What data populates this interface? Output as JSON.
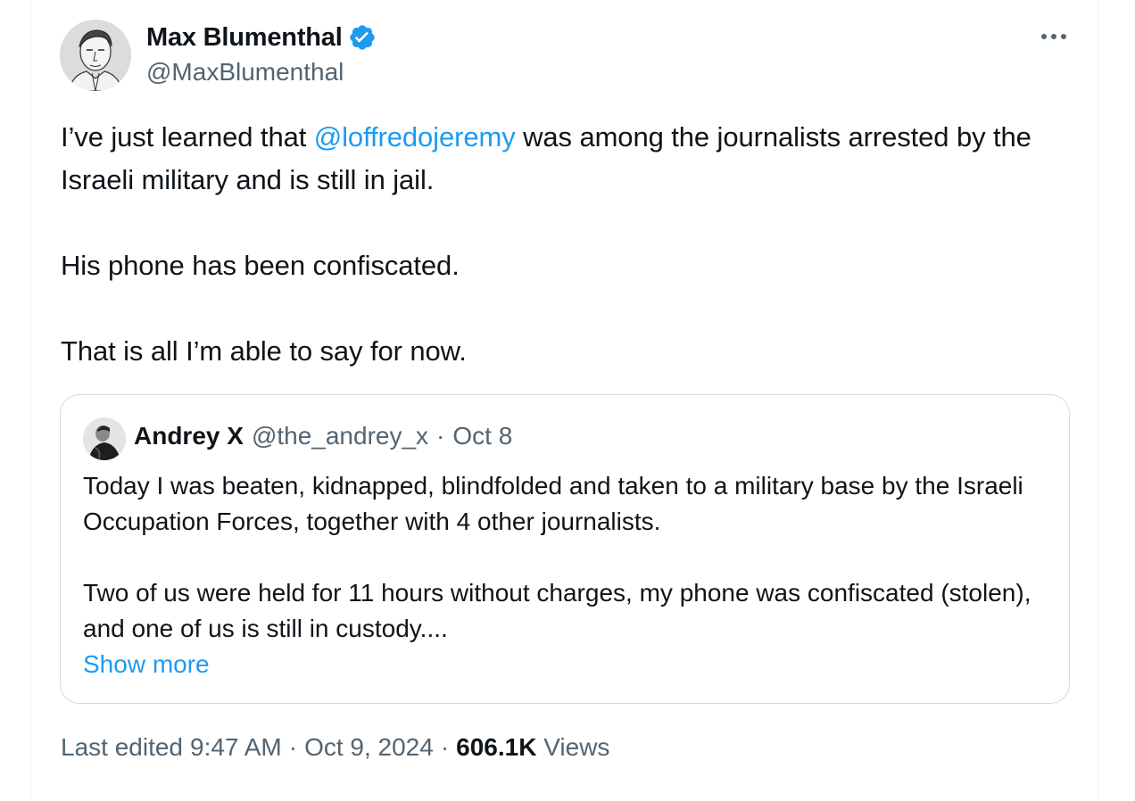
{
  "author": {
    "name": "Max Blumenthal",
    "handle": "@MaxBlumenthal",
    "verified": true,
    "avatar_icon": "avatar-sketch-portrait"
  },
  "menu": {
    "more_icon": "more-horizontal-icon"
  },
  "tweet": {
    "text_part1": "I’ve just learned that ",
    "mention": "@loffredojeremy",
    "text_part2": " was among the journalists arrested by the Israeli military and is still in jail.",
    "paragraph2": "His phone has been confiscated.",
    "paragraph3": "That is all I’m able to say for now."
  },
  "quote": {
    "name": "Andrey X",
    "handle": "@the_andrey_x",
    "separator": "·",
    "date": "Oct 8",
    "paragraph1": "Today I was beaten, kidnapped, blindfolded and taken to a military base by the Israeli Occupation Forces, together with 4 other journalists.",
    "paragraph2": "Two of us were held for 11 hours without charges, my phone was confiscated (stolen), and one of us is still in custody....",
    "show_more": "Show more"
  },
  "meta": {
    "edited_label": "Last edited",
    "time": "9:47 AM",
    "separator": "·",
    "date": "Oct 9, 2024",
    "views_count": "606.1K",
    "views_label": "Views"
  },
  "colors": {
    "link_blue": "#1d9bf0",
    "verified_blue": "#1d9bf0",
    "secondary_text": "#536471",
    "primary_text": "#0f1419",
    "border": "#cfd9de"
  }
}
